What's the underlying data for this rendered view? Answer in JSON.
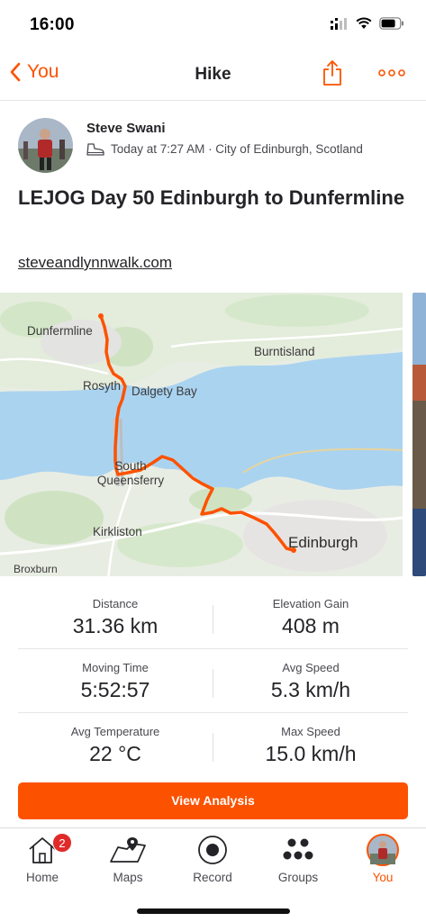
{
  "status_bar": {
    "time": "16:00"
  },
  "nav": {
    "back_label": "You",
    "title": "Hike"
  },
  "athlete": {
    "name": "Steve Swani",
    "meta": "Today at 7:27 AM · City of Edinburgh, Scotland"
  },
  "activity": {
    "title": "LEJOG Day 50 Edinburgh to Dunfermline",
    "link": "steveandlynnwalk.com"
  },
  "map": {
    "places": {
      "dunfermline": "Dunfermline",
      "burntisland": "Burntisland",
      "rosyth": "Rosyth",
      "dalgety_bay": "Dalgety Bay",
      "south_queensferry": "South Queensferry",
      "kirkliston": "Kirkliston",
      "edinburgh": "Edinburgh",
      "broxburn": "Broxburn"
    },
    "route_color": "#fc5200",
    "water_color": "#aad3f0",
    "land_color": "#dfead6"
  },
  "stats": {
    "distance": {
      "label": "Distance",
      "value": "31.36 km"
    },
    "elevation": {
      "label": "Elevation Gain",
      "value": "408 m"
    },
    "moving_time": {
      "label": "Moving Time",
      "value": "5:52:57"
    },
    "avg_speed": {
      "label": "Avg Speed",
      "value": "5.3 km/h"
    },
    "avg_temp": {
      "label": "Avg Temperature",
      "value": "22 °C"
    },
    "max_speed": {
      "label": "Max Speed",
      "value": "15.0 km/h"
    }
  },
  "buttons": {
    "view_analysis": "View Analysis"
  },
  "tabs": [
    {
      "label": "Home",
      "icon": "home-icon",
      "badge": "2"
    },
    {
      "label": "Maps",
      "icon": "map-icon"
    },
    {
      "label": "Record",
      "icon": "record-icon"
    },
    {
      "label": "Groups",
      "icon": "groups-icon"
    },
    {
      "label": "You",
      "icon": "avatar",
      "active": true
    }
  ],
  "colors": {
    "accent": "#fc5200",
    "text": "#242428",
    "badge": "#e02a2a"
  }
}
